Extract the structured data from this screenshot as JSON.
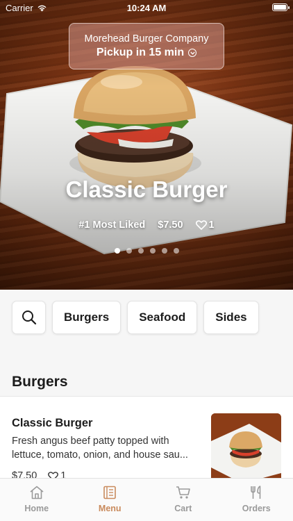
{
  "status_bar": {
    "carrier": "Carrier",
    "time": "10:24 AM"
  },
  "store": {
    "name": "Morehead Burger Company",
    "pickup": "Pickup in 15 min"
  },
  "featured": {
    "title": "Classic Burger",
    "rank": "#1 Most Liked",
    "price": "$7.50",
    "likes": "1",
    "slide_count": 6,
    "active_slide": 1
  },
  "categories": {
    "search_icon": "search-icon",
    "items": [
      {
        "label": "Burgers"
      },
      {
        "label": "Seafood"
      },
      {
        "label": "Sides"
      }
    ]
  },
  "menu": {
    "section_title": "Burgers",
    "items": [
      {
        "name": "Classic Burger",
        "description_line1": "Fresh angus beef patty topped with",
        "description_line2": "lettuce, tomato, onion, and house sau...",
        "price": "$7.50",
        "likes": "1"
      }
    ]
  },
  "tabbar": {
    "active_color": "#c98a5c",
    "inactive_color": "#9a9a9a",
    "tabs": [
      {
        "label": "Home",
        "icon": "home-icon"
      },
      {
        "label": "Menu",
        "icon": "menu-icon",
        "active": true
      },
      {
        "label": "Cart",
        "icon": "cart-icon"
      },
      {
        "label": "Orders",
        "icon": "fork-knife-icon"
      }
    ]
  }
}
